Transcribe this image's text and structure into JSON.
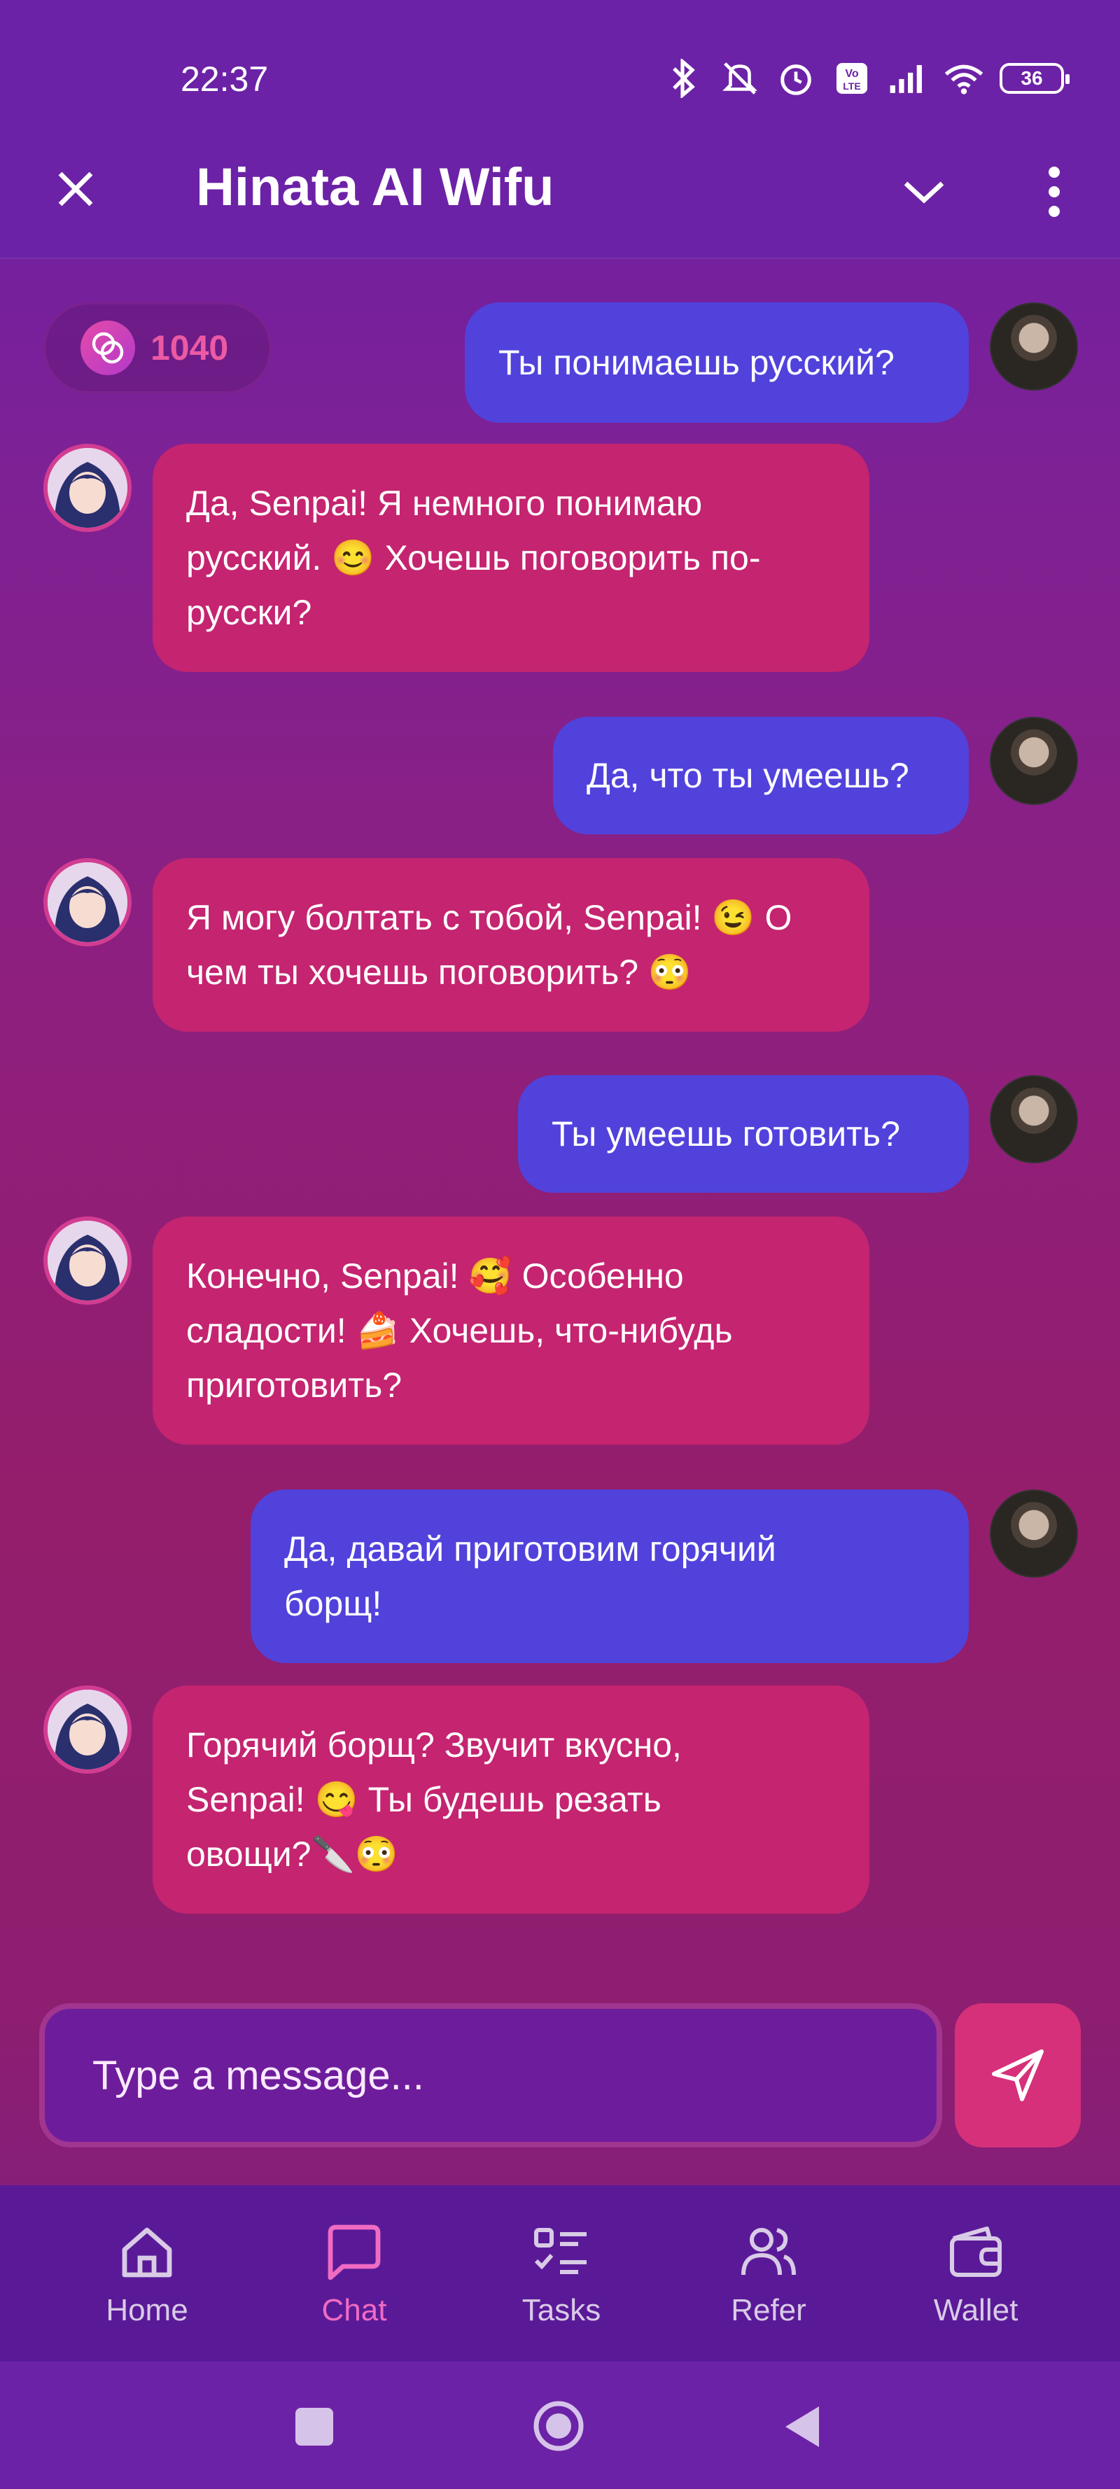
{
  "status_bar": {
    "time": "22:37",
    "battery": "36",
    "icons": [
      "bluetooth-icon",
      "mute-icon",
      "alarm-icon",
      "volte-icon",
      "signal-icon",
      "wifi-icon",
      "battery-icon"
    ]
  },
  "header": {
    "title": "Hinata AI Wifu",
    "close_icon": "close-icon",
    "chevron_icon": "chevron-down-icon",
    "menu_icon": "more-vertical-icon"
  },
  "coins": {
    "value": "1040",
    "icon": "coins-icon"
  },
  "messages": [
    {
      "from": "user",
      "lines": [
        "Ты понимаешь русский?"
      ]
    },
    {
      "from": "bot",
      "lines": [
        "Да, Senpai! Я немного понимаю",
        "русский. 😊 Хочешь поговорить по-",
        "русски?"
      ]
    },
    {
      "from": "user",
      "lines": [
        "Да, что ты умеешь?"
      ]
    },
    {
      "from": "bot",
      "lines": [
        "Я могу болтать с тобой, Senpai! 😉 О",
        "чем ты хочешь поговорить? 😳"
      ]
    },
    {
      "from": "user",
      "lines": [
        "Ты умеешь готовить?"
      ]
    },
    {
      "from": "bot",
      "lines": [
        "Конечно, Senpai! 🥰 Особенно",
        "сладости! 🍰 Хочешь, что-нибудь",
        "приготовить?"
      ]
    },
    {
      "from": "user",
      "lines": [
        "Да, давай приготовим горячий",
        "борщ!"
      ]
    },
    {
      "from": "bot",
      "lines": [
        "Горячий борщ? Звучит вкусно,",
        "Senpai! 😋 Ты будешь резать",
        "овощи?🔪😳"
      ]
    }
  ],
  "composer": {
    "placeholder": "Type a message...",
    "send_icon": "send-icon"
  },
  "bottom_nav": {
    "items": [
      {
        "label": "Home",
        "icon": "home-icon"
      },
      {
        "label": "Chat",
        "icon": "chat-icon",
        "active": true
      },
      {
        "label": "Tasks",
        "icon": "tasks-icon"
      },
      {
        "label": "Refer",
        "icon": "refer-icon"
      },
      {
        "label": "Wallet",
        "icon": "wallet-icon"
      }
    ]
  },
  "colors": {
    "user_bubble": "#5142dc",
    "bot_bubble": "#c42470",
    "accent": "#f06bc2",
    "header": "#6c22a6"
  }
}
